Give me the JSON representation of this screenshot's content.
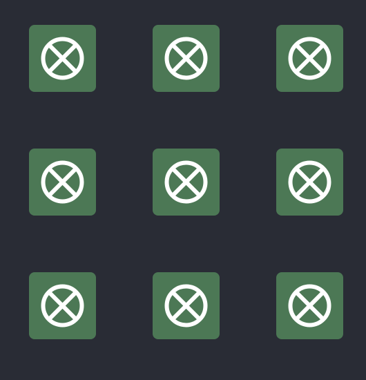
{
  "colors": {
    "background": "#292c35",
    "cell": "#4c7855",
    "mark": "#ffffff"
  },
  "board": {
    "cells": [
      "X",
      "O",
      "",
      "",
      "",
      "",
      "",
      "",
      ""
    ]
  }
}
